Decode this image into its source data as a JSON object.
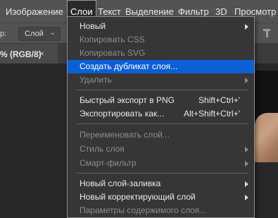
{
  "menubar": {
    "items": [
      "Изображение",
      "Слои",
      "Текст",
      "Выделение",
      "Фильтр",
      "3D",
      "Просмотр"
    ],
    "active_index": 1
  },
  "optbar": {
    "label": "р:",
    "select_value": "Слой",
    "icon": "align-top-icon"
  },
  "doc_tab": {
    "label": "% (RGB/8)",
    "close": "×"
  },
  "dropdown": {
    "items": [
      {
        "label": "Новый",
        "shortcut": "",
        "submenu": true,
        "disabled": false,
        "highlighted": false
      },
      {
        "label": "Копировать CSS",
        "shortcut": "",
        "submenu": false,
        "disabled": true,
        "highlighted": false
      },
      {
        "label": "Копировать SVG",
        "shortcut": "",
        "submenu": false,
        "disabled": true,
        "highlighted": false
      },
      {
        "label": "Создать дубликат слоя...",
        "shortcut": "",
        "submenu": false,
        "disabled": false,
        "highlighted": true
      },
      {
        "label": "Удалить",
        "shortcut": "",
        "submenu": true,
        "disabled": true,
        "highlighted": false
      },
      {
        "label": "Быстрый экспорт в PNG",
        "shortcut": "Shift+Ctrl+'",
        "submenu": false,
        "disabled": false,
        "highlighted": false
      },
      {
        "label": "Экспортировать как...",
        "shortcut": "Alt+Shift+Ctrl+'",
        "submenu": false,
        "disabled": false,
        "highlighted": false
      },
      {
        "label": "Переименовать слой...",
        "shortcut": "",
        "submenu": false,
        "disabled": true,
        "highlighted": false
      },
      {
        "label": "Стиль слоя",
        "shortcut": "",
        "submenu": true,
        "disabled": true,
        "highlighted": false
      },
      {
        "label": "Смарт-фильтр",
        "shortcut": "",
        "submenu": true,
        "disabled": true,
        "highlighted": false
      },
      {
        "label": "Новый слой-заливка",
        "shortcut": "",
        "submenu": true,
        "disabled": false,
        "highlighted": false
      },
      {
        "label": "Новый корректирующий слой",
        "shortcut": "",
        "submenu": true,
        "disabled": false,
        "highlighted": false
      },
      {
        "label": "Параметры содержимого слоя...",
        "shortcut": "",
        "submenu": false,
        "disabled": true,
        "highlighted": false
      }
    ]
  },
  "colors": {
    "menubar_bg": "#535353",
    "menu_bg": "#363636",
    "highlight": "#0b5fd7",
    "disabled_text": "#8d8d8d"
  }
}
